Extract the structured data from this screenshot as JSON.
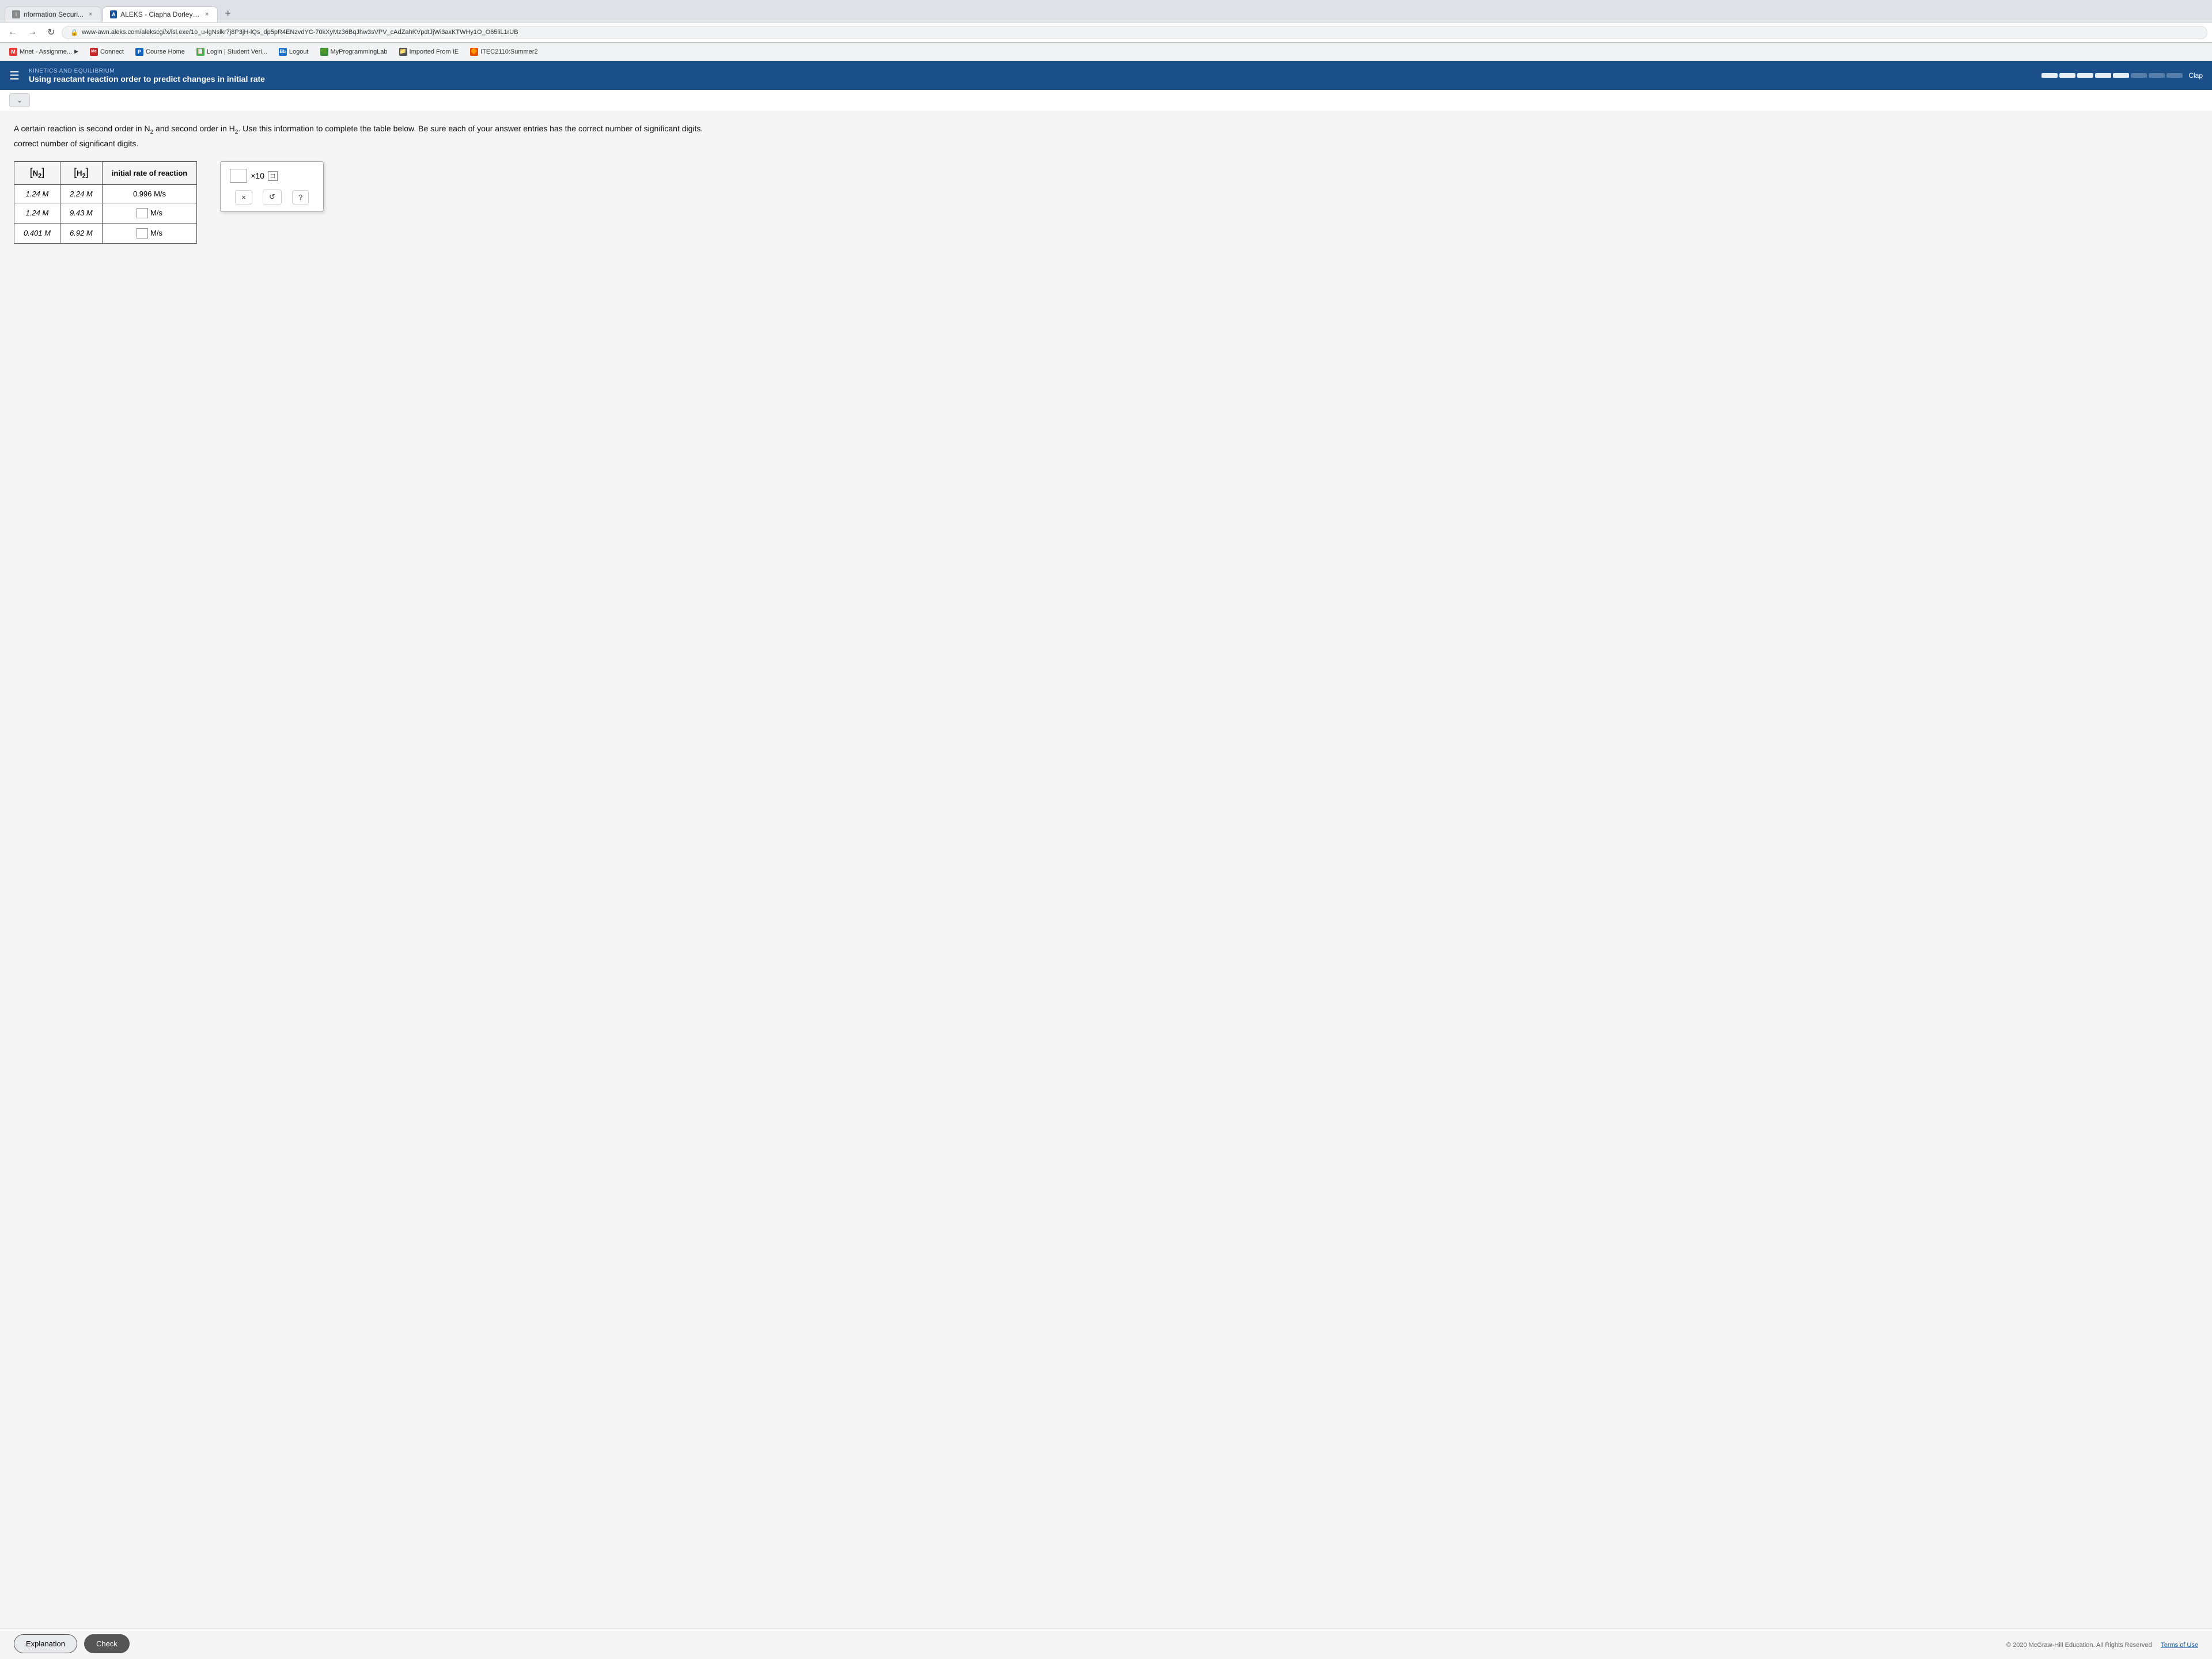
{
  "browser": {
    "tabs": [
      {
        "id": "tab-info",
        "title": "nformation Securi...",
        "favicon_type": "info",
        "favicon_label": "i",
        "active": false
      },
      {
        "id": "tab-aleks",
        "title": "ALEKS - Ciapha Dorley - Learn",
        "favicon_type": "aleks",
        "favicon_label": "A",
        "active": true
      }
    ],
    "new_tab_label": "+",
    "url": "www-awn.aleks.com/alekscgi/x/lsl.exe/1o_u-lgNslkr7j8P3jH-lQs_dp5pR4ENzvdYC-70kXyMz36BqJhw3sVPV_cAdZahKVpdtJjWi3axKTWHy1O_O65liL1rUB",
    "secure_label": "🔒"
  },
  "bookmarks": [
    {
      "id": "bm-mnet",
      "label": "Mnet - Assignme...",
      "icon_color": "#e53935",
      "icon_label": "M"
    },
    {
      "id": "bm-connect",
      "label": "Connect",
      "icon_color": "#c62828",
      "icon_label": "Mc"
    },
    {
      "id": "bm-course-home",
      "label": "Course Home",
      "icon_color": "#1565c0",
      "icon_label": "P"
    },
    {
      "id": "bm-login",
      "label": "Login | Student Veri...",
      "icon_color": "#4caf50",
      "icon_label": "📋"
    },
    {
      "id": "bm-logout",
      "label": "Logout",
      "icon_color": "#1976d2",
      "icon_label": "Bb"
    },
    {
      "id": "bm-myproglab",
      "label": "MyProgrammingLab",
      "icon_color": "#388e3c",
      "icon_label": "🌿"
    },
    {
      "id": "bm-imported",
      "label": "Imported From IE",
      "icon_color": "#555",
      "icon_label": "📁"
    },
    {
      "id": "bm-itec",
      "label": "ITEC2110:Summer2",
      "icon_color": "#e65100",
      "icon_label": "🔶"
    }
  ],
  "aleks_nav": {
    "section_label": "KINETICS AND EQUILIBRIUM",
    "topic_title": "Using reactant reaction order to predict changes in initial rate",
    "clap_text": "Clap"
  },
  "progress": {
    "filled_segments": 5,
    "total_segments": 8
  },
  "problem": {
    "text_before_n2": "A certain reaction is second order in N",
    "n2_sub": "2",
    "text_between": " and second order in H",
    "h2_sub": "2",
    "text_after": ". Use this information to complete the table below. Be sure each of your answer entries has the correct number of significant digits."
  },
  "table": {
    "col1_header": "[N₂]",
    "col2_header": "[H₂]",
    "col3_header": "initial rate of reaction",
    "rows": [
      {
        "n2": "1.24 M",
        "h2": "2.24 M",
        "rate": "0.996 M/s",
        "rate_input": false
      },
      {
        "n2": "1.24 M",
        "h2": "9.43 M",
        "rate": "",
        "rate_input": true
      },
      {
        "n2": "0.401 M",
        "h2": "6.92 M",
        "rate": "",
        "rate_input": true
      }
    ],
    "unit": "M/s"
  },
  "popup": {
    "x10_label": "×10",
    "exponent_placeholder": "□",
    "close_btn": "×",
    "reset_btn": "↺",
    "help_btn": "?"
  },
  "bottom": {
    "explanation_btn": "Explanation",
    "check_btn": "Check",
    "copyright": "© 2020 McGraw-Hill Education. All Rights Reserved",
    "terms": "Terms of Use"
  }
}
